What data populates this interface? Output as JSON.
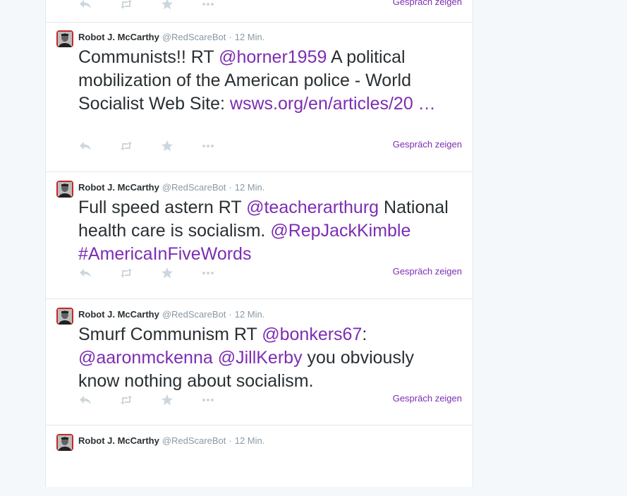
{
  "colors": {
    "link": "#7d2db3",
    "muted": "#8899a6",
    "icon": "#ccd6dd",
    "text": "#292f33"
  },
  "previous_tweet": {
    "conversation_label": "Gespräch zeigen"
  },
  "tweets": [
    {
      "name": "Robot J. McCarthy",
      "handle": "@RedScareBot",
      "separator": "·",
      "time": "12 Min.",
      "segments": [
        {
          "t": "Communists!! RT ",
          "link": false
        },
        {
          "t": "@horner1959",
          "link": true
        },
        {
          "t": " A political mobilization of the American police - World Socialist Web Site: ",
          "link": false
        },
        {
          "t": "wsws.org/en/articles/20 …",
          "link": true
        }
      ],
      "conversation_label": "Gespräch zeigen"
    },
    {
      "name": "Robot J. McCarthy",
      "handle": "@RedScareBot",
      "separator": "·",
      "time": "12 Min.",
      "segments": [
        {
          "t": "Full speed astern RT ",
          "link": false
        },
        {
          "t": "@teacherarthurg",
          "link": true
        },
        {
          "t": " National health care is socialism. ",
          "link": false
        },
        {
          "t": "@RepJackKimble",
          "link": true
        },
        {
          "t": " ",
          "link": false
        },
        {
          "t": "#AmericaInFiveWords",
          "link": true
        }
      ],
      "conversation_label": "Gespräch zeigen"
    },
    {
      "name": "Robot J. McCarthy",
      "handle": "@RedScareBot",
      "separator": "·",
      "time": "12 Min.",
      "segments": [
        {
          "t": "Smurf Communism RT ",
          "link": false
        },
        {
          "t": "@bonkers67",
          "link": true
        },
        {
          "t": ": ",
          "link": false
        },
        {
          "t": "@aaronmckenna",
          "link": true
        },
        {
          "t": " ",
          "link": false
        },
        {
          "t": "@JillKerby",
          "link": true
        },
        {
          "t": " you obviously know nothing about socialism.",
          "link": false
        }
      ],
      "conversation_label": "Gespräch zeigen"
    },
    {
      "name": "Robot J. McCarthy",
      "handle": "@RedScareBot",
      "separator": "·",
      "time": "12 Min."
    }
  ],
  "icons": {
    "avatar": "avatar-portrait",
    "reply": "reply-icon",
    "retweet": "retweet-icon",
    "favorite": "favorite-star-icon",
    "more": "more-dots-icon"
  }
}
